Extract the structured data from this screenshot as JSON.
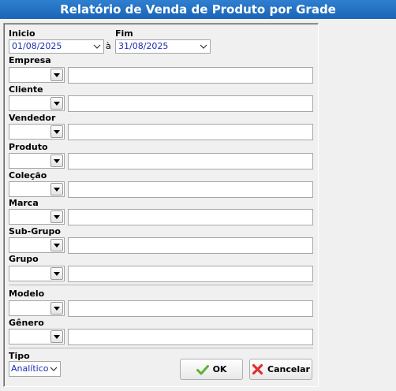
{
  "window": {
    "title": "Relatório de Venda de Produto por Grade"
  },
  "period": {
    "start_label": "Inicio",
    "start_value": "01/08/2025",
    "between": "à",
    "end_label": "Fim",
    "end_value": "31/08/2025"
  },
  "filters": [
    {
      "label": "Empresa"
    },
    {
      "label": "Cliente"
    },
    {
      "label": "Vendedor"
    },
    {
      "label": "Produto"
    },
    {
      "label": "Coleção"
    },
    {
      "label": "Marca"
    },
    {
      "label": "Sub-Grupo"
    },
    {
      "label": "Grupo"
    },
    {
      "label": "Modelo"
    },
    {
      "label": "Gênero"
    }
  ],
  "tipo": {
    "label": "Tipo",
    "value": "Analítico"
  },
  "buttons": {
    "ok": "OK",
    "cancel": "Cancelar"
  },
  "colors": {
    "title_bar": "#1b64b6",
    "value_text": "#1b2bb5",
    "ok_icon": "#5bb233",
    "cancel_icon": "#e0302c"
  }
}
